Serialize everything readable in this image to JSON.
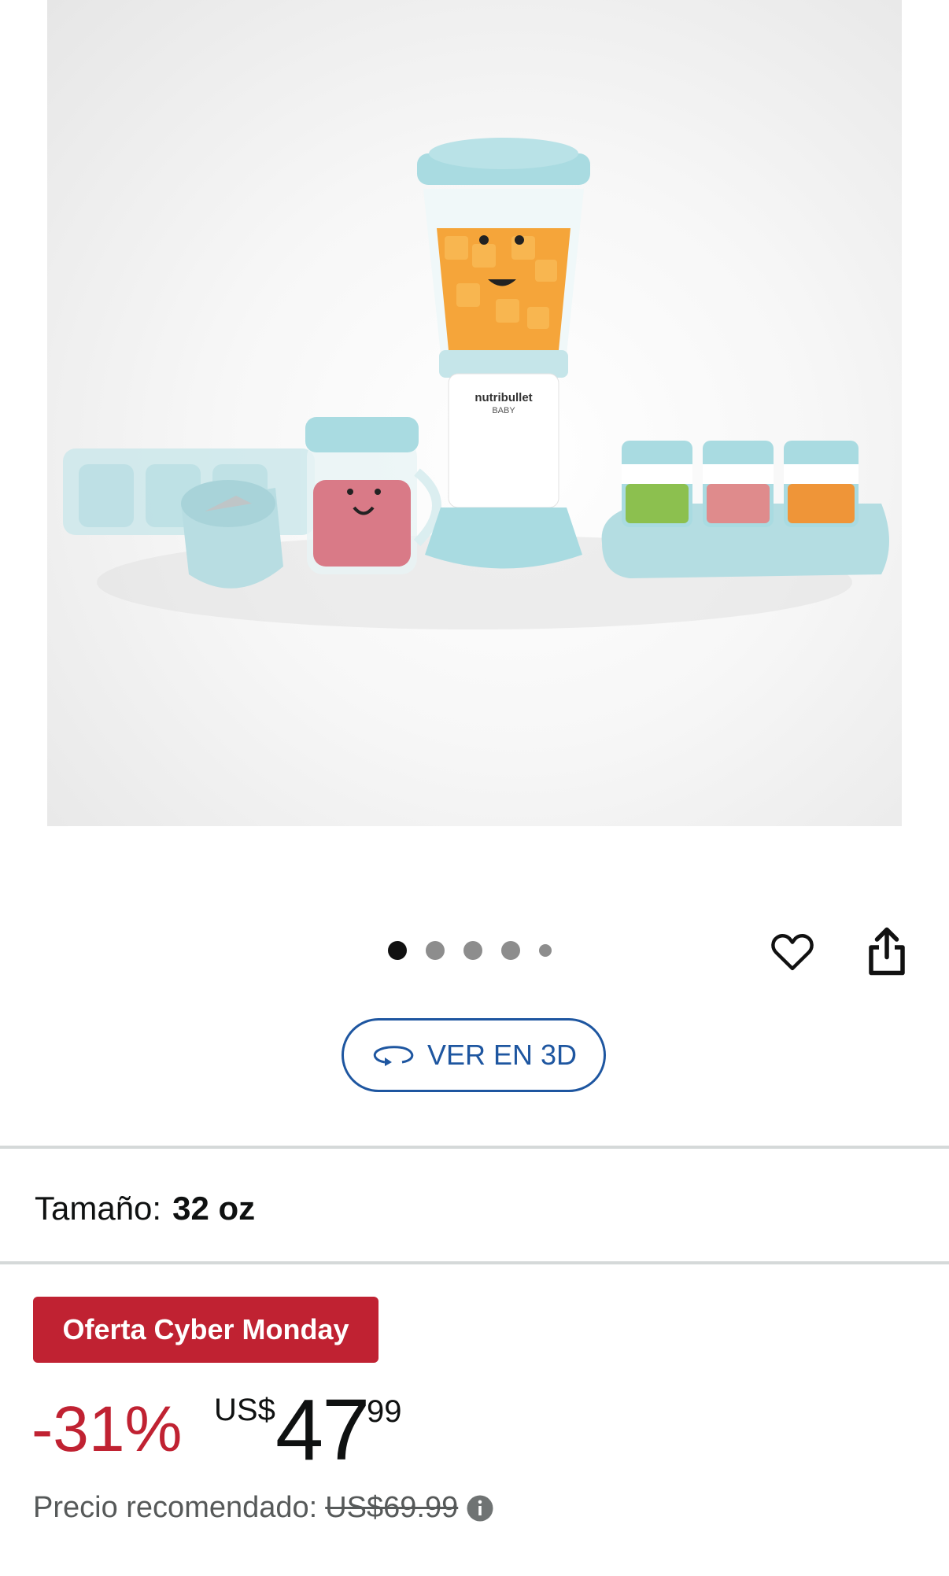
{
  "product": {
    "image_alt": "nutribullet BABY",
    "brand_on_product": "nutribullet",
    "brand_sub": "BABY"
  },
  "carousel": {
    "total": 5,
    "active": 0
  },
  "actions": {
    "favorite_icon": "heart-icon",
    "share_icon": "share-icon",
    "view_3d_label": "VER EN 3D",
    "view_3d_icon": "rotate-3d-icon"
  },
  "size": {
    "label": "Tamaño:",
    "value": "32 oz"
  },
  "deal": {
    "badge": "Oferta Cyber Monday"
  },
  "price": {
    "discount": "-31%",
    "currency": "US$",
    "whole": "47",
    "cents": "99"
  },
  "list_price": {
    "label": "Precio recomendado:",
    "value": "US$69.99",
    "info_icon": "info-icon"
  },
  "colors": {
    "deal_red": "#c02232",
    "link_blue": "#1e56a0",
    "product_mint": "#bfe3e8"
  }
}
